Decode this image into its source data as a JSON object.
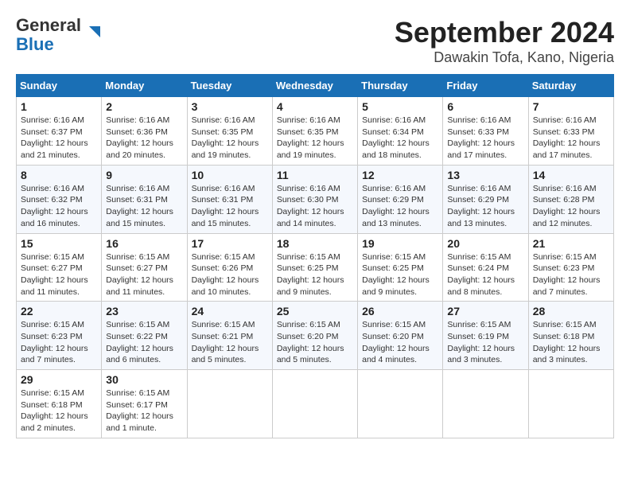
{
  "logo": {
    "line1": "General",
    "line2": "Blue"
  },
  "title": "September 2024",
  "location": "Dawakin Tofa, Kano, Nigeria",
  "days_of_week": [
    "Sunday",
    "Monday",
    "Tuesday",
    "Wednesday",
    "Thursday",
    "Friday",
    "Saturday"
  ],
  "weeks": [
    [
      {
        "day": "1",
        "info": "Sunrise: 6:16 AM\nSunset: 6:37 PM\nDaylight: 12 hours\nand 21 minutes."
      },
      {
        "day": "2",
        "info": "Sunrise: 6:16 AM\nSunset: 6:36 PM\nDaylight: 12 hours\nand 20 minutes."
      },
      {
        "day": "3",
        "info": "Sunrise: 6:16 AM\nSunset: 6:35 PM\nDaylight: 12 hours\nand 19 minutes."
      },
      {
        "day": "4",
        "info": "Sunrise: 6:16 AM\nSunset: 6:35 PM\nDaylight: 12 hours\nand 19 minutes."
      },
      {
        "day": "5",
        "info": "Sunrise: 6:16 AM\nSunset: 6:34 PM\nDaylight: 12 hours\nand 18 minutes."
      },
      {
        "day": "6",
        "info": "Sunrise: 6:16 AM\nSunset: 6:33 PM\nDaylight: 12 hours\nand 17 minutes."
      },
      {
        "day": "7",
        "info": "Sunrise: 6:16 AM\nSunset: 6:33 PM\nDaylight: 12 hours\nand 17 minutes."
      }
    ],
    [
      {
        "day": "8",
        "info": "Sunrise: 6:16 AM\nSunset: 6:32 PM\nDaylight: 12 hours\nand 16 minutes."
      },
      {
        "day": "9",
        "info": "Sunrise: 6:16 AM\nSunset: 6:31 PM\nDaylight: 12 hours\nand 15 minutes."
      },
      {
        "day": "10",
        "info": "Sunrise: 6:16 AM\nSunset: 6:31 PM\nDaylight: 12 hours\nand 15 minutes."
      },
      {
        "day": "11",
        "info": "Sunrise: 6:16 AM\nSunset: 6:30 PM\nDaylight: 12 hours\nand 14 minutes."
      },
      {
        "day": "12",
        "info": "Sunrise: 6:16 AM\nSunset: 6:29 PM\nDaylight: 12 hours\nand 13 minutes."
      },
      {
        "day": "13",
        "info": "Sunrise: 6:16 AM\nSunset: 6:29 PM\nDaylight: 12 hours\nand 13 minutes."
      },
      {
        "day": "14",
        "info": "Sunrise: 6:16 AM\nSunset: 6:28 PM\nDaylight: 12 hours\nand 12 minutes."
      }
    ],
    [
      {
        "day": "15",
        "info": "Sunrise: 6:15 AM\nSunset: 6:27 PM\nDaylight: 12 hours\nand 11 minutes."
      },
      {
        "day": "16",
        "info": "Sunrise: 6:15 AM\nSunset: 6:27 PM\nDaylight: 12 hours\nand 11 minutes."
      },
      {
        "day": "17",
        "info": "Sunrise: 6:15 AM\nSunset: 6:26 PM\nDaylight: 12 hours\nand 10 minutes."
      },
      {
        "day": "18",
        "info": "Sunrise: 6:15 AM\nSunset: 6:25 PM\nDaylight: 12 hours\nand 9 minutes."
      },
      {
        "day": "19",
        "info": "Sunrise: 6:15 AM\nSunset: 6:25 PM\nDaylight: 12 hours\nand 9 minutes."
      },
      {
        "day": "20",
        "info": "Sunrise: 6:15 AM\nSunset: 6:24 PM\nDaylight: 12 hours\nand 8 minutes."
      },
      {
        "day": "21",
        "info": "Sunrise: 6:15 AM\nSunset: 6:23 PM\nDaylight: 12 hours\nand 7 minutes."
      }
    ],
    [
      {
        "day": "22",
        "info": "Sunrise: 6:15 AM\nSunset: 6:23 PM\nDaylight: 12 hours\nand 7 minutes."
      },
      {
        "day": "23",
        "info": "Sunrise: 6:15 AM\nSunset: 6:22 PM\nDaylight: 12 hours\nand 6 minutes."
      },
      {
        "day": "24",
        "info": "Sunrise: 6:15 AM\nSunset: 6:21 PM\nDaylight: 12 hours\nand 5 minutes."
      },
      {
        "day": "25",
        "info": "Sunrise: 6:15 AM\nSunset: 6:20 PM\nDaylight: 12 hours\nand 5 minutes."
      },
      {
        "day": "26",
        "info": "Sunrise: 6:15 AM\nSunset: 6:20 PM\nDaylight: 12 hours\nand 4 minutes."
      },
      {
        "day": "27",
        "info": "Sunrise: 6:15 AM\nSunset: 6:19 PM\nDaylight: 12 hours\nand 3 minutes."
      },
      {
        "day": "28",
        "info": "Sunrise: 6:15 AM\nSunset: 6:18 PM\nDaylight: 12 hours\nand 3 minutes."
      }
    ],
    [
      {
        "day": "29",
        "info": "Sunrise: 6:15 AM\nSunset: 6:18 PM\nDaylight: 12 hours\nand 2 minutes."
      },
      {
        "day": "30",
        "info": "Sunrise: 6:15 AM\nSunset: 6:17 PM\nDaylight: 12 hours\nand 1 minute."
      },
      null,
      null,
      null,
      null,
      null
    ]
  ]
}
